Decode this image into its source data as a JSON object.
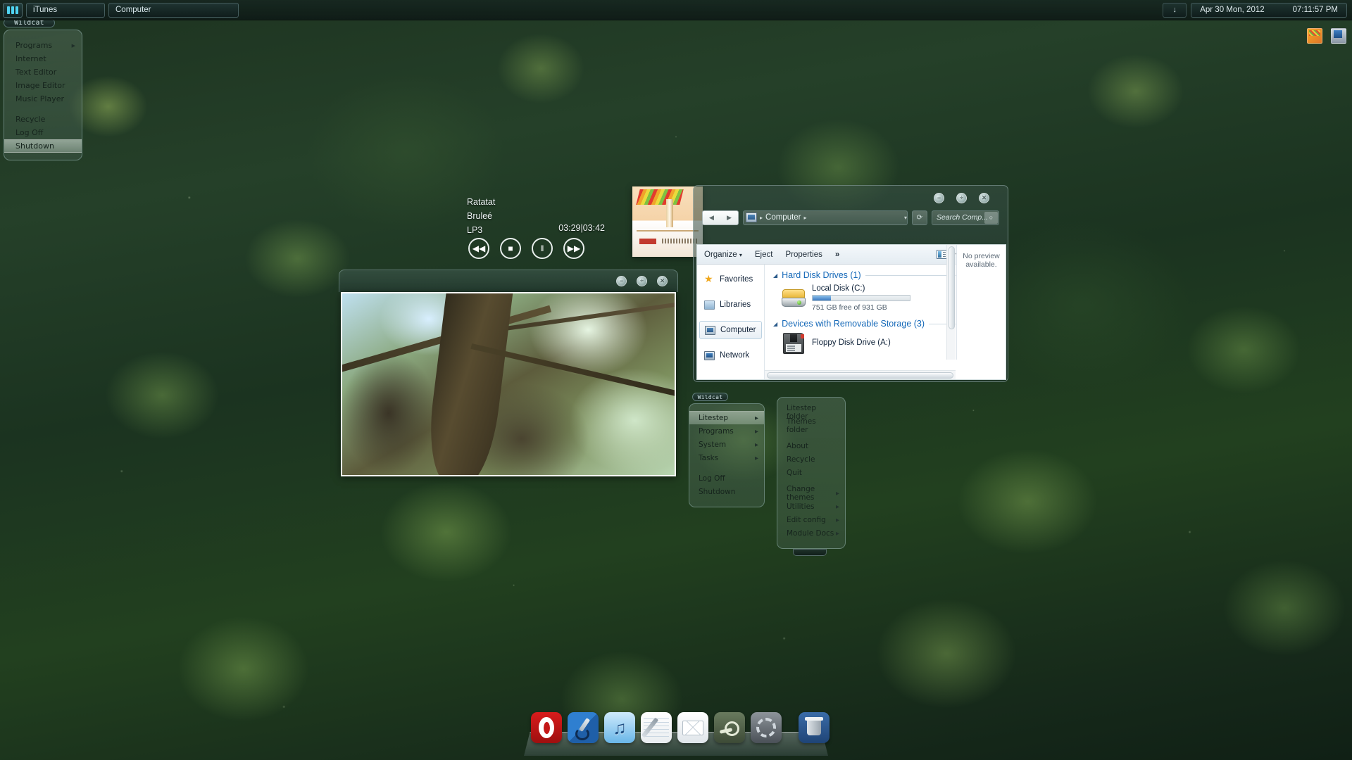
{
  "taskbar": {
    "logo_name": "start-logo",
    "tasks": [
      {
        "label": "iTunes"
      },
      {
        "label": "Computer"
      }
    ],
    "tray_toggle": "↓",
    "clock": {
      "date": "Apr 30 Mon, 2012",
      "time": "07:11:57 PM"
    }
  },
  "start_menu": {
    "caption": "Wildcat",
    "items": [
      {
        "label": "Programs",
        "has_submenu": true,
        "selected": false
      },
      {
        "label": "Internet",
        "has_submenu": false,
        "selected": false
      },
      {
        "label": "Text Editor",
        "has_submenu": false,
        "selected": false
      },
      {
        "label": "Image Editor",
        "has_submenu": false,
        "selected": false
      },
      {
        "label": "Music Player",
        "has_submenu": false,
        "selected": false
      },
      {
        "label": "Recycle",
        "has_submenu": false,
        "selected": false,
        "gap_before": true
      },
      {
        "label": "Log Off",
        "has_submenu": false,
        "selected": false
      },
      {
        "label": "Shutdown",
        "has_submenu": false,
        "selected": true
      }
    ]
  },
  "player": {
    "artist": "Ratatat",
    "track": "Bruleé",
    "album": "LP3",
    "time": "03:29|03:42",
    "controls": [
      {
        "name": "previous-button",
        "glyph": "◀◀"
      },
      {
        "name": "stop-button",
        "glyph": "■"
      },
      {
        "name": "pause-button",
        "glyph": "‖"
      },
      {
        "name": "next-button",
        "glyph": "▶▶"
      }
    ],
    "album_art_name": "album-art"
  },
  "viewer": {
    "window_buttons": [
      {
        "name": "minimize-button",
        "glyph": "−"
      },
      {
        "name": "maximize-button",
        "glyph": "÷"
      },
      {
        "name": "close-button",
        "glyph": "✕"
      }
    ]
  },
  "explorer": {
    "window_buttons": [
      {
        "name": "minimize-button",
        "glyph": "−"
      },
      {
        "name": "maximize-button",
        "glyph": "÷"
      },
      {
        "name": "close-button",
        "glyph": "✕"
      }
    ],
    "back_glyph": "◀",
    "forward_glyph": "▶",
    "breadcrumb": {
      "root": "Computer",
      "sep": "▸",
      "dropdown": "▾"
    },
    "refresh_glyph": "⟳",
    "search": {
      "placeholder": "Search Comp...",
      "button_glyph": "○"
    },
    "toolbar": {
      "organize": "Organize",
      "organize_caret": "▾",
      "eject": "Eject",
      "properties": "Properties",
      "more": "»",
      "view_caret": "▾"
    },
    "sidebar": [
      {
        "label": "Favorites",
        "icon": "star-icon",
        "selected": false
      },
      {
        "label": "Libraries",
        "icon": "libraries-icon",
        "selected": false
      },
      {
        "label": "Computer",
        "icon": "computer-icon",
        "selected": true
      },
      {
        "label": "Network",
        "icon": "network-icon",
        "selected": false
      }
    ],
    "groups": [
      {
        "title": "Hard Disk Drives (1)",
        "arrow": "◢",
        "items": [
          {
            "name": "Local Disk (C:)",
            "free_text": "751 GB free of 931 GB",
            "used_percent": 19,
            "icon": "hard-disk-icon"
          }
        ]
      },
      {
        "title": "Devices with Removable Storage (3)",
        "arrow": "◢",
        "items": [
          {
            "name": "Floppy Disk Drive (A:)",
            "icon": "floppy-disk-icon"
          }
        ]
      }
    ],
    "preview": {
      "line1": "No preview",
      "line2": "available."
    }
  },
  "litestep_menu": {
    "caption": "Wildcat",
    "items": [
      {
        "label": "Litestep",
        "has_submenu": true,
        "selected": true
      },
      {
        "label": "Programs",
        "has_submenu": true,
        "selected": false
      },
      {
        "label": "System",
        "has_submenu": true,
        "selected": false
      },
      {
        "label": "Tasks",
        "has_submenu": true,
        "selected": false
      },
      {
        "label": "Log Off",
        "has_submenu": false,
        "selected": false,
        "gap_before": true
      },
      {
        "label": "Shutdown",
        "has_submenu": false,
        "selected": false
      }
    ],
    "submenu": [
      {
        "label": "Litestep folder",
        "has_submenu": false
      },
      {
        "label": "Themes folder",
        "has_submenu": false
      },
      {
        "label": "About",
        "has_submenu": false,
        "gap_before": true
      },
      {
        "label": "Recycle",
        "has_submenu": false
      },
      {
        "label": "Quit",
        "has_submenu": false
      },
      {
        "label": "Change themes",
        "has_submenu": true,
        "gap_before": true
      },
      {
        "label": "Utilities",
        "has_submenu": true
      },
      {
        "label": "Edit config",
        "has_submenu": true
      },
      {
        "label": "Module Docs",
        "has_submenu": true
      }
    ]
  },
  "dock": {
    "items": [
      {
        "name": "opera-icon",
        "label": "Opera"
      },
      {
        "name": "paint-net-icon",
        "label": "Paint.NET"
      },
      {
        "name": "itunes-icon",
        "label": "iTunes"
      },
      {
        "name": "notepad-icon",
        "label": "Notepad"
      },
      {
        "name": "mail-icon",
        "label": "Mail"
      },
      {
        "name": "steam-icon",
        "label": "Steam"
      },
      {
        "name": "settings-icon",
        "label": "Settings"
      },
      {
        "name": "recycle-bin-icon",
        "label": "Recycle Bin"
      }
    ]
  },
  "desktop_icons": [
    {
      "name": "paint-shortcut-icon"
    },
    {
      "name": "network-shortcut-icon"
    }
  ],
  "colors": {
    "accent_blue": "#1468b8",
    "taskbar_bg": "#16261f",
    "menu_text": "#16241d",
    "drive_bar": "#3a79c0"
  }
}
